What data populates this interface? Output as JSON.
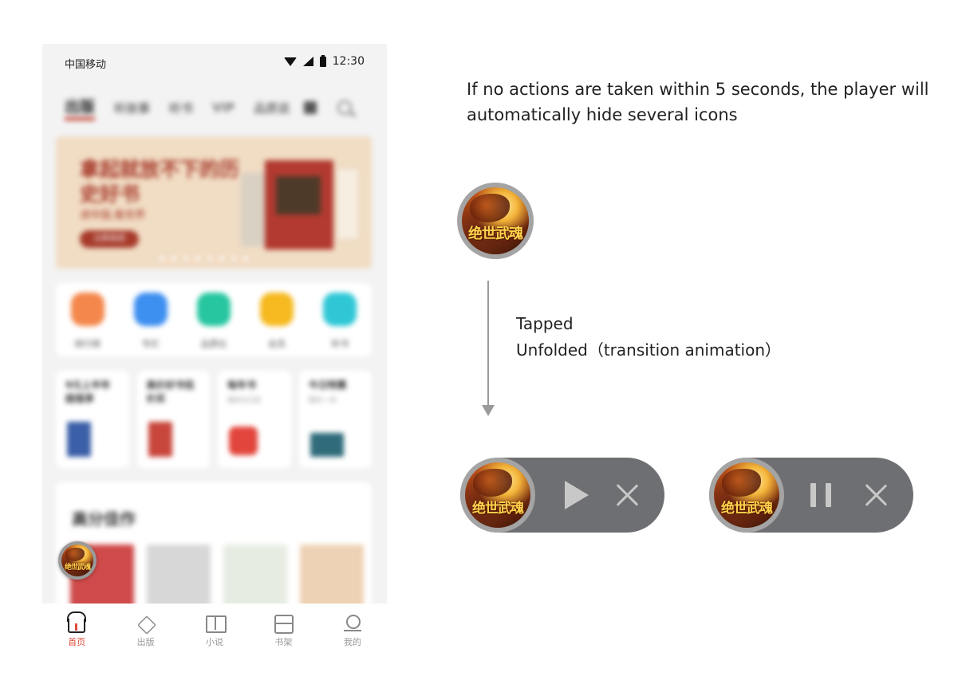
{
  "phone": {
    "status_bar": {
      "carrier": "中国移动",
      "time": "12:30"
    },
    "top_nav": {
      "tabs": [
        "出版",
        "听故事",
        "听书",
        "VIP",
        "品质说"
      ]
    },
    "banner": {
      "title": "拿起就放不下的历史好书",
      "subtitle": "读中国,看世界",
      "button": "立即阅读"
    },
    "quick_entries": [
      {
        "label": "排行榜",
        "color": "#f4874b"
      },
      {
        "label": "专栏",
        "color": "#3d8ff0"
      },
      {
        "label": "品质社",
        "color": "#26c6a0"
      },
      {
        "label": "会员",
        "color": "#f6b91f"
      },
      {
        "label": "听书",
        "color": "#2fc7d6"
      }
    ],
    "feature_cards": [
      {
        "title": "9元上半年超值享",
        "sub": ""
      },
      {
        "title": "高价好书低价买",
        "sub": ""
      },
      {
        "title": "每年书",
        "sub": "限时0元领"
      },
      {
        "title": "今日特惠",
        "sub": "限时一折"
      }
    ],
    "recommend": {
      "title": "高分佳作"
    },
    "tabbar": {
      "items": [
        {
          "label": "首页",
          "icon": "home-icon",
          "active": true
        },
        {
          "label": "出版",
          "icon": "layers-icon",
          "active": false
        },
        {
          "label": "小说",
          "icon": "book-open-icon",
          "active": false
        },
        {
          "label": "书架",
          "icon": "bookshelf-icon",
          "active": false
        },
        {
          "label": "我的",
          "icon": "person-icon",
          "active": false
        }
      ]
    }
  },
  "annotations": {
    "idle_note": "If no actions are taken within 5 seconds, the player will automatically hide several icons",
    "tap_line1": "Tapped",
    "tap_line2": "Unfolded（transition animation）"
  },
  "player": {
    "cover_text": "绝世武魂",
    "collapsed": {
      "icon": "album-cover"
    },
    "expanded_paused": {
      "controls": [
        "play-icon",
        "close-icon"
      ]
    },
    "expanded_playing": {
      "controls": [
        "pause-icon",
        "close-icon"
      ]
    }
  },
  "colors": {
    "pill_bg": "#6e6f72",
    "control_icon": "#c8c8c8",
    "active_tab": "#e04a3a",
    "arrow": "#9a9a9a"
  }
}
